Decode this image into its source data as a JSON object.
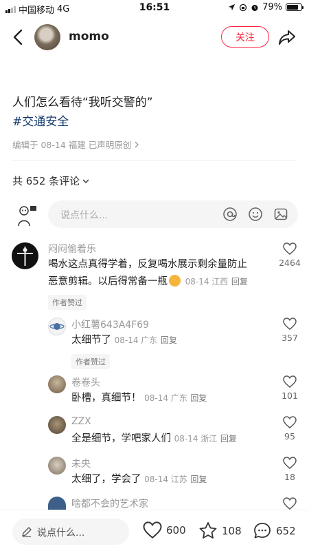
{
  "status_bar": {
    "carrier": "中国移动",
    "network": "4G",
    "time": "16:51",
    "battery": "79%",
    "battery_level": 0.79
  },
  "header": {
    "username": "momo",
    "follow_label": "关注"
  },
  "note": {
    "title": "人们怎么看待“我听交警的”",
    "tag": "#交通安全",
    "meta": "编辑于 08-14 福建  已声明原创"
  },
  "comments_section": {
    "count_label": "共 652 条评论",
    "input_placeholder": "说点什么..."
  },
  "comments": [
    {
      "name": "闷闷偷着乐",
      "line1": "喝水这点真得学着，反复喝水展示剩余量防止",
      "line2": "恶意剪辑。以后得常备一瓶",
      "meta": "08-14 江西",
      "reply": "回复",
      "badge": "作者赞过",
      "likes": "2464"
    },
    {
      "name": "小红薯643A4F69",
      "text": "太细节了",
      "meta": "08-14 广东",
      "reply": "回复",
      "badge": "作者赞过",
      "likes": "357"
    },
    {
      "name": "卷卷头",
      "text": "卧槽，真细节！",
      "meta": "08-14 广东",
      "reply": "回复",
      "likes": "101"
    },
    {
      "name": "ZZX",
      "text": "全是细节，学吧家人们",
      "meta": "08-14 浙江",
      "reply": "回复",
      "likes": "95"
    },
    {
      "name": "未央",
      "text": "太细了，学会了",
      "meta": "08-14 江苏",
      "reply": "回复",
      "likes": "18"
    },
    {
      "name": "啥都不会的艺术家"
    }
  ],
  "bottom_bar": {
    "say_placeholder": "说点什么...",
    "likes": "600",
    "collects": "108",
    "comments": "652"
  },
  "colors": {
    "accent": "#ff2442",
    "tag": "#13386c"
  }
}
